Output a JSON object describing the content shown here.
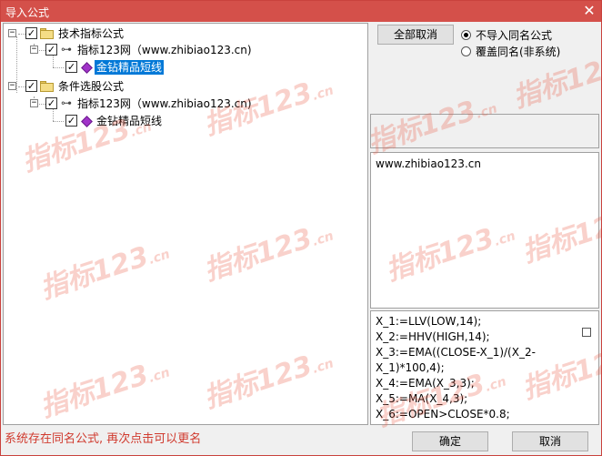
{
  "window": {
    "title": "导入公式",
    "close_glyph": "✕"
  },
  "tree": {
    "groups": [
      {
        "label": "技术指标公式",
        "expander": "−",
        "checked": "✓",
        "source": {
          "label": "指标123网（www.zhibiao123.cn)",
          "expander": "−",
          "checked": "✓"
        },
        "formula": {
          "label": "金钻精品短线",
          "checked": "✓",
          "selected": true
        }
      },
      {
        "label": "条件选股公式",
        "expander": "−",
        "checked": "✓",
        "source": {
          "label": "指标123网（www.zhibiao123.cn)",
          "expander": "−",
          "checked": "✓"
        },
        "formula": {
          "label": "金钻精品短线",
          "checked": "✓",
          "selected": false
        }
      }
    ]
  },
  "controls": {
    "cancel_all": "全部取消",
    "radio_no_import": "不导入同名公式",
    "radio_overwrite": "覆盖同名(非系统)",
    "selected_option": "不导入同名公式"
  },
  "description": {
    "text": "www.zhibiao123.cn"
  },
  "code": {
    "lines": [
      "X_1:=LLV(LOW,14);",
      "X_2:=HHV(HIGH,14);",
      "X_3:=EMA((CLOSE-X_1)/(X_2-",
      "X_1)*100,4);",
      "X_4:=EMA(X_3,3);",
      "X_5:=MA(X_4,3);",
      "X_6:=OPEN>CLOSE*0.8;"
    ]
  },
  "status": {
    "message": "系统存在同名公式, 再次点击可以更名",
    "color": "#d03a2e"
  },
  "footer": {
    "ok": "确定",
    "cancel": "取消"
  },
  "watermark": {
    "text": "指标123",
    "suffix": ".cn",
    "color": "#eb5a46"
  }
}
